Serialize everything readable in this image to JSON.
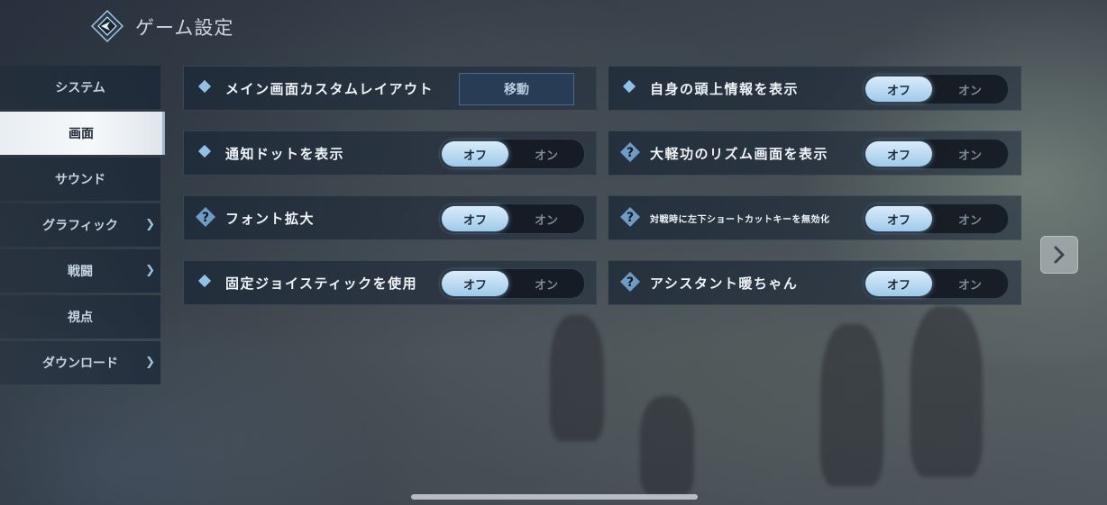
{
  "header": {
    "title": "ゲーム設定",
    "logo_icon": "diamond-emblem-icon"
  },
  "sidebar": {
    "items": [
      {
        "label": "システム",
        "chevron": false,
        "active": false
      },
      {
        "label": "画面",
        "chevron": false,
        "active": true
      },
      {
        "label": "サウンド",
        "chevron": false,
        "active": false
      },
      {
        "label": "グラフィック",
        "chevron": true,
        "active": false
      },
      {
        "label": "戦闘",
        "chevron": true,
        "active": false
      },
      {
        "label": "視点",
        "chevron": false,
        "active": false
      },
      {
        "label": "ダウンロード",
        "chevron": true,
        "active": false
      }
    ],
    "chevron_glyph": "❯"
  },
  "settings": {
    "left": [
      {
        "label": "メイン画面カスタムレイアウト",
        "icon": "diamond-bullet-icon",
        "control": "button",
        "button_label": "移動"
      },
      {
        "label": "通知ドットを表示",
        "icon": "diamond-bullet-icon",
        "control": "toggle",
        "off_label": "オフ",
        "on_label": "オン",
        "value": "オフ"
      },
      {
        "label": "フォント拡大",
        "icon": "help-diamond-icon",
        "control": "toggle",
        "off_label": "オフ",
        "on_label": "オン",
        "value": "オフ"
      },
      {
        "label": "固定ジョイスティックを使用",
        "icon": "diamond-bullet-icon",
        "control": "toggle",
        "off_label": "オフ",
        "on_label": "オン",
        "value": "オフ"
      }
    ],
    "right": [
      {
        "label": "自身の頭上情報を表示",
        "icon": "diamond-bullet-icon",
        "control": "toggle",
        "off_label": "オフ",
        "on_label": "オン",
        "value": "オフ"
      },
      {
        "label": "大軽功のリズム画面を表示",
        "icon": "help-diamond-icon",
        "control": "toggle",
        "off_label": "オフ",
        "on_label": "オン",
        "value": "オフ"
      },
      {
        "label": "対戦時に左下ショートカットキーを無効化",
        "icon": "help-diamond-icon",
        "control": "toggle",
        "off_label": "オフ",
        "on_label": "オン",
        "value": "オフ"
      },
      {
        "label": "アシスタント暖ちゃん",
        "icon": "help-diamond-icon",
        "control": "toggle",
        "off_label": "オフ",
        "on_label": "オン",
        "value": "オフ"
      }
    ]
  },
  "pager": {
    "next_icon": "chevron-right-icon"
  },
  "colors": {
    "accent": "#9fcaea",
    "panel": "#1c2837",
    "active_tab": "#f0f4f7"
  }
}
